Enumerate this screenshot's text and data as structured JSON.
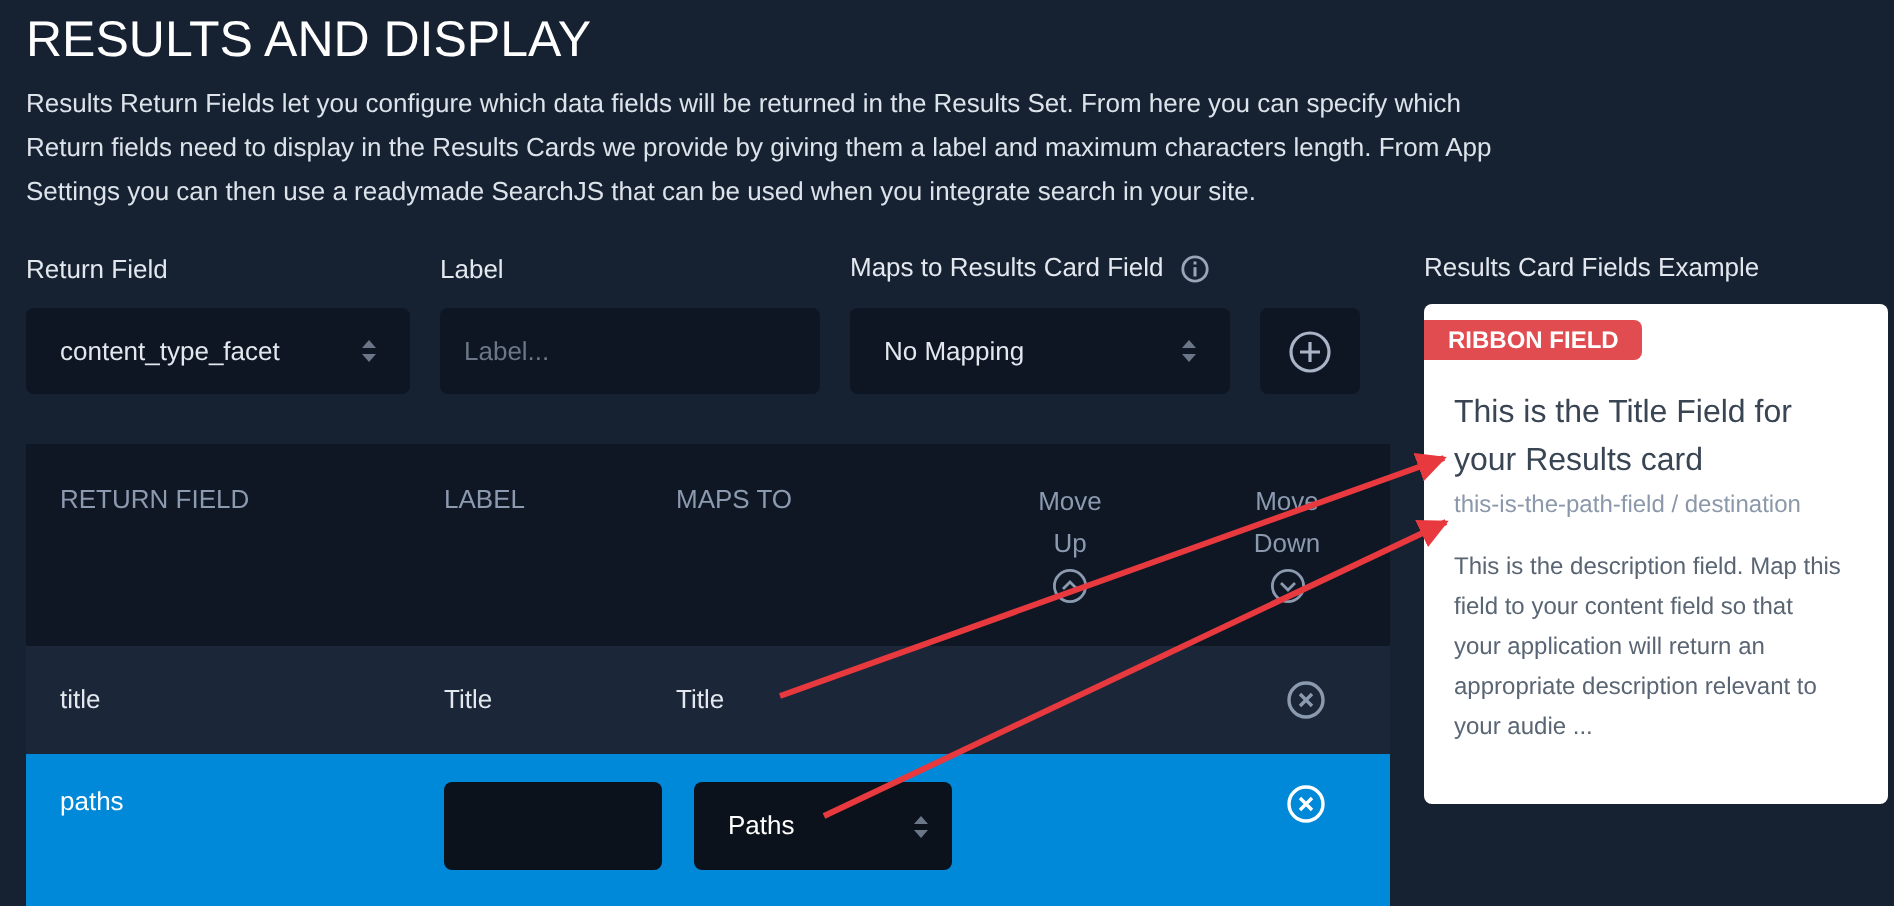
{
  "heading": "RESULTS AND DISPLAY",
  "description": "Results Return Fields let you configure which data fields will be returned in the Results Set. From here you can specify which Return fields need to display in the Results Cards we provide by giving them a label and maximum characters length. From App Settings you can then use a readymade SearchJS that can be used when you integrate search in your site.",
  "form": {
    "return_field": {
      "label": "Return Field",
      "value": "content_type_facet"
    },
    "label_field": {
      "label": "Label",
      "placeholder": "Label..."
    },
    "maps_to": {
      "label": "Maps to Results Card Field",
      "value": "No Mapping"
    }
  },
  "table": {
    "columns": [
      "RETURN FIELD",
      "LABEL",
      "MAPS TO",
      "Move Up",
      "Move Down"
    ],
    "rows": [
      {
        "return_field": "title",
        "label": "Title",
        "maps_to": "Title",
        "selected": false
      },
      {
        "return_field": "paths",
        "label": "",
        "maps_to": "Paths",
        "selected": true
      }
    ]
  },
  "example": {
    "heading": "Results Card Fields Example",
    "ribbon": "RIBBON FIELD",
    "title": "This is the Title Field for your Results card",
    "path": "this-is-the-path-field / destination",
    "description": "This is the description field. Map this field to your content field so that your application will return an appropriate description relevant to your audie ..."
  }
}
